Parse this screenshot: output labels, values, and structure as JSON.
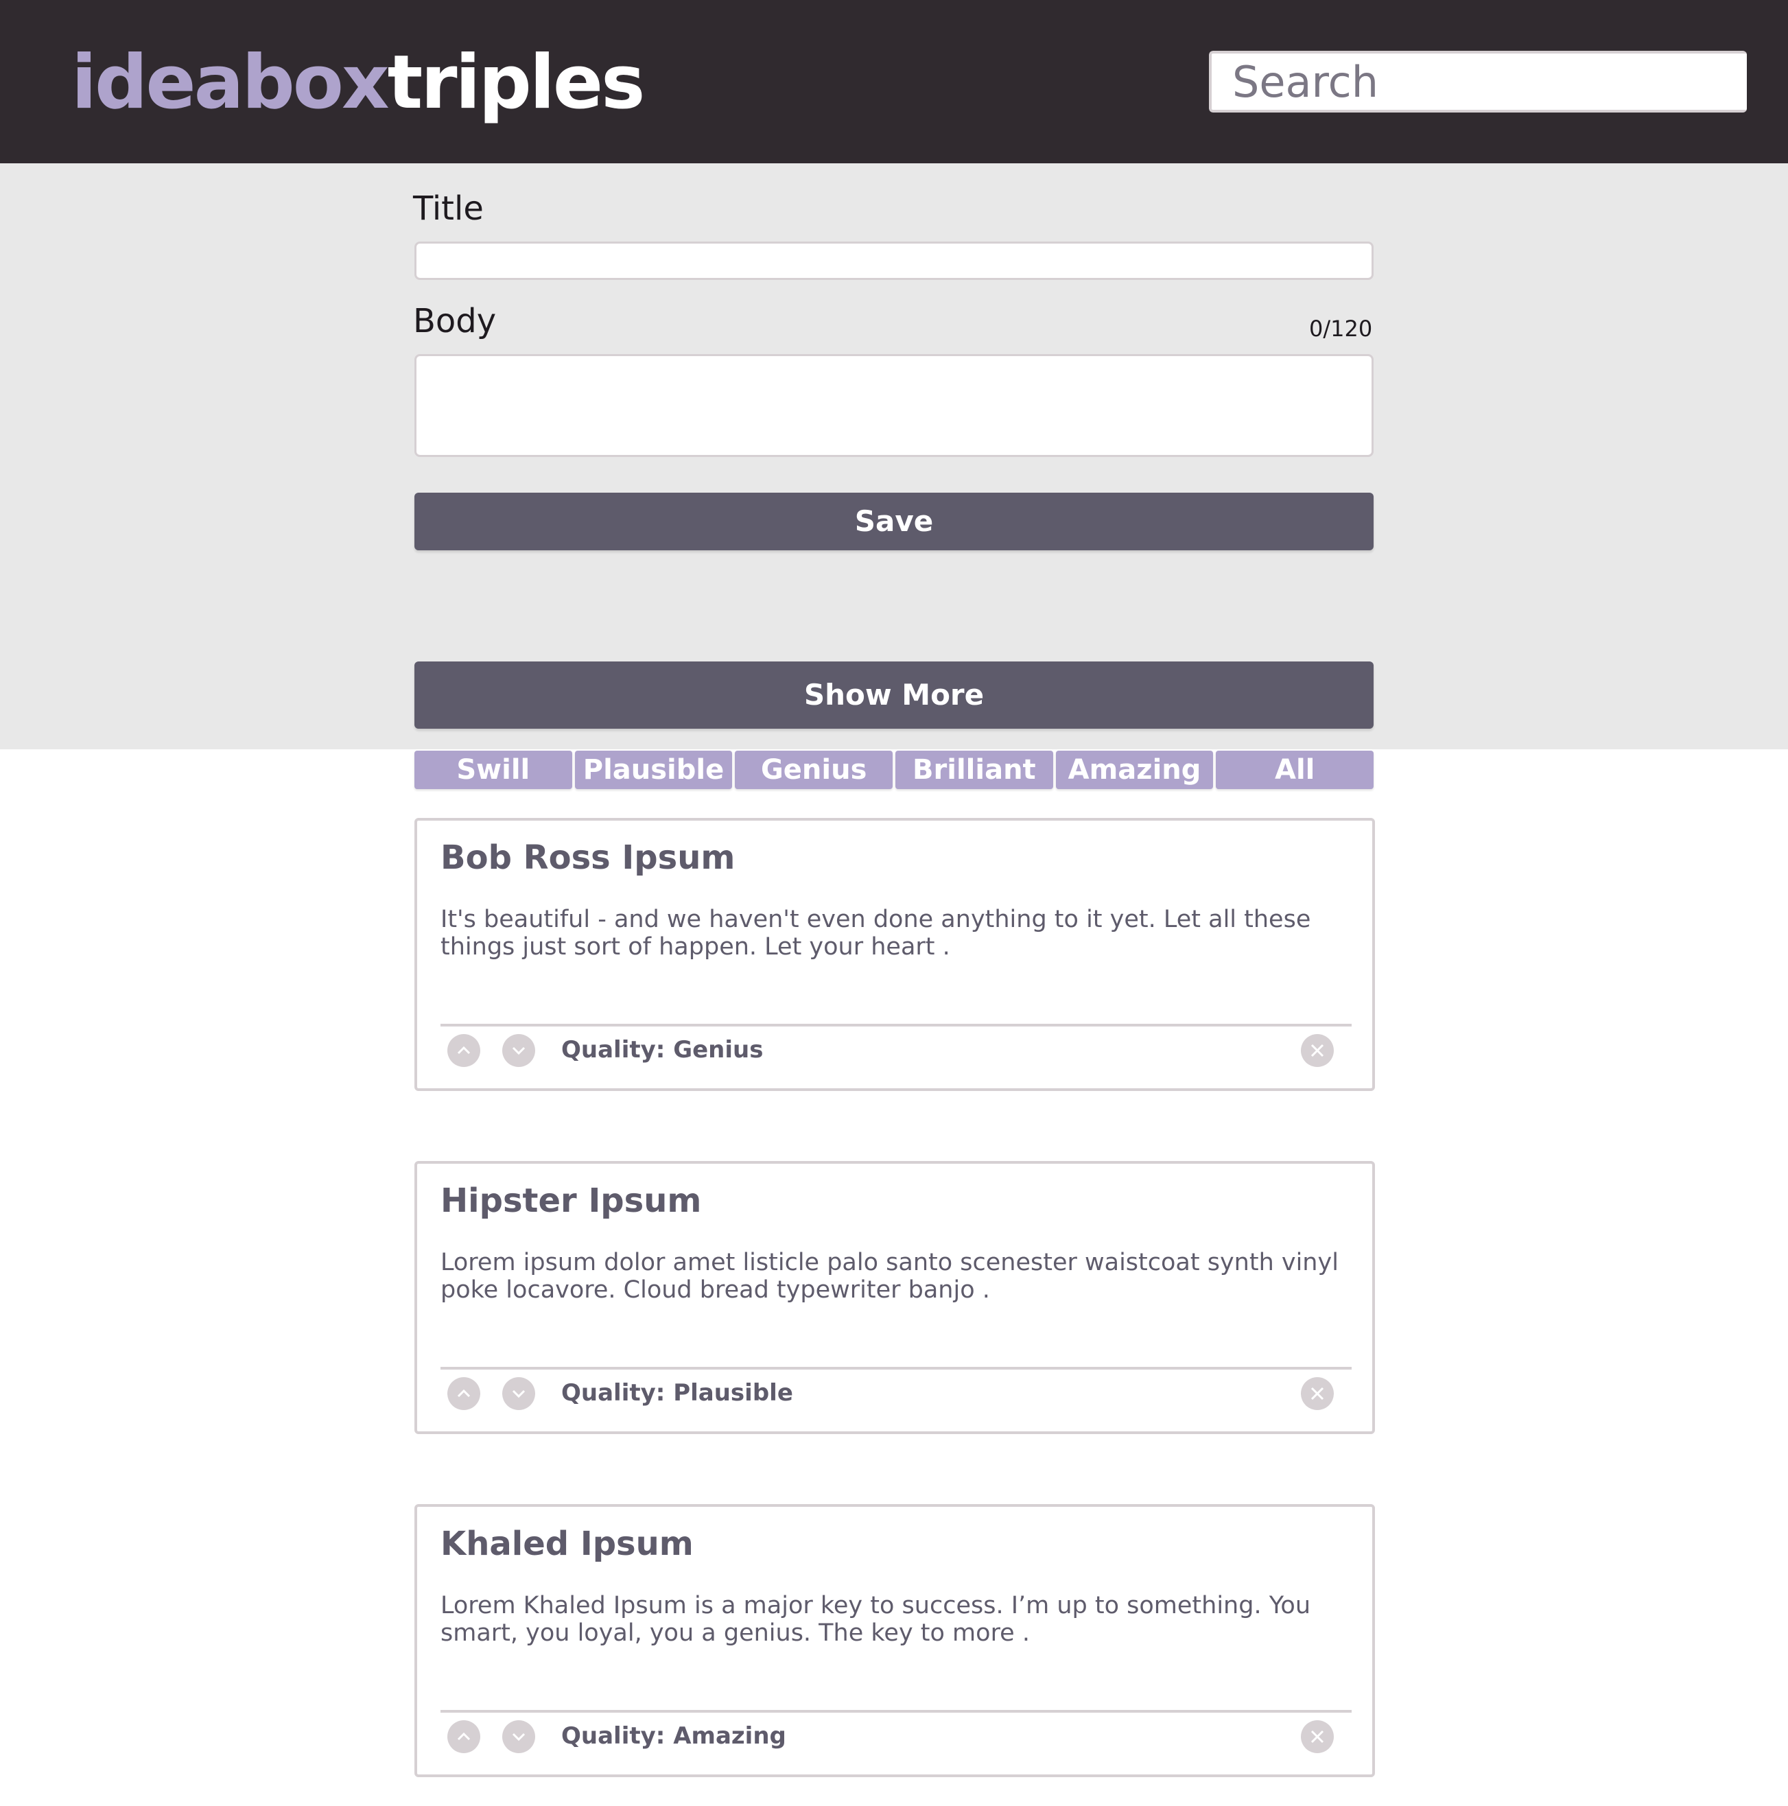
{
  "app": {
    "logo_part1": "ideabox",
    "logo_part2": "triples"
  },
  "search": {
    "placeholder": "Search",
    "icon": "search-icon"
  },
  "form": {
    "title_label": "Title",
    "body_label": "Body",
    "char_counter": "0/120",
    "save_label": "Save",
    "show_more_label": "Show More"
  },
  "filters": [
    "Swill",
    "Plausible",
    "Genius",
    "Brilliant",
    "Amazing",
    "All"
  ],
  "cards": [
    {
      "title": "Bob Ross Ipsum",
      "body": "It's beautiful - and we haven't even done anything to it yet. Let all these things just sort of happen. Let your heart .",
      "quality": "Quality: Genius"
    },
    {
      "title": "Hipster Ipsum",
      "body": "Lorem ipsum dolor amet listicle palo santo scenester waistcoat synth vinyl poke locavore. Cloud bread typewriter banjo .",
      "quality": "Quality: Plausible"
    },
    {
      "title": "Khaled Ipsum",
      "body": "Lorem Khaled Ipsum is a major key to success. I’m up to something. You smart, you loyal, you a genius. The key to more .",
      "quality": "Quality: Amazing"
    }
  ],
  "colors": {
    "header_bg": "#302a2f",
    "accent_purple": "#aea3cc",
    "button_dark": "#5e5b6b",
    "form_bg": "#e8e8e8",
    "border_gray": "#d6d0d3"
  }
}
